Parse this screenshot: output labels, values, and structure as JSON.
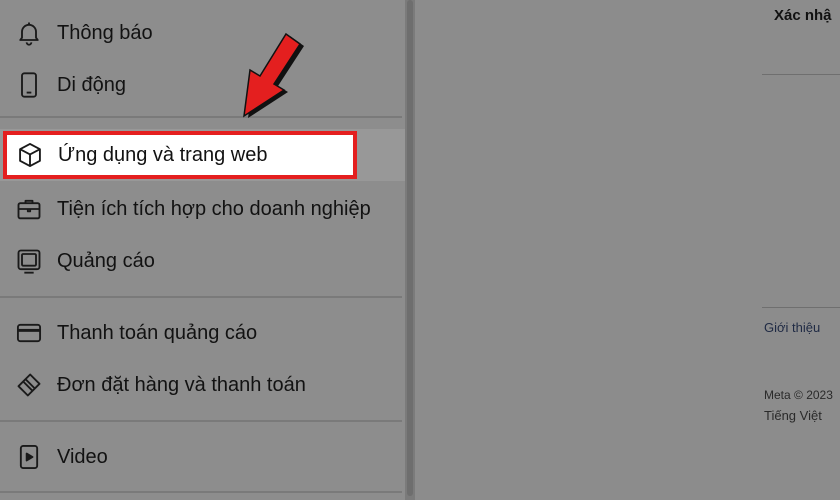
{
  "menu": {
    "items": [
      {
        "icon": "bell-icon",
        "label": "Thông báo"
      },
      {
        "icon": "mobile-phone-icon",
        "label": "Di động"
      },
      {
        "icon": "cube-icon",
        "label": "Ứng dụng và trang web"
      },
      {
        "icon": "briefcase-icon",
        "label": "Tiện ích tích hợp cho doanh nghiệp"
      },
      {
        "icon": "ad-screen-icon",
        "label": "Quảng cáo"
      },
      {
        "icon": "credit-card-icon",
        "label": "Thanh toán quảng cáo"
      },
      {
        "icon": "tag-card-icon",
        "label": "Đơn đặt hàng và thanh toán"
      },
      {
        "icon": "video-icon",
        "label": "Video"
      }
    ],
    "selected_index": 2
  },
  "right_panel": {
    "confirm_text": "Xác nhậ",
    "about_link": "Giới thiệu",
    "copyright": "Meta © 2023",
    "language": "Tiếng Việt"
  },
  "annotation": {
    "highlight_color": "#e41f1f",
    "arrow_color": "#e41f1f"
  }
}
